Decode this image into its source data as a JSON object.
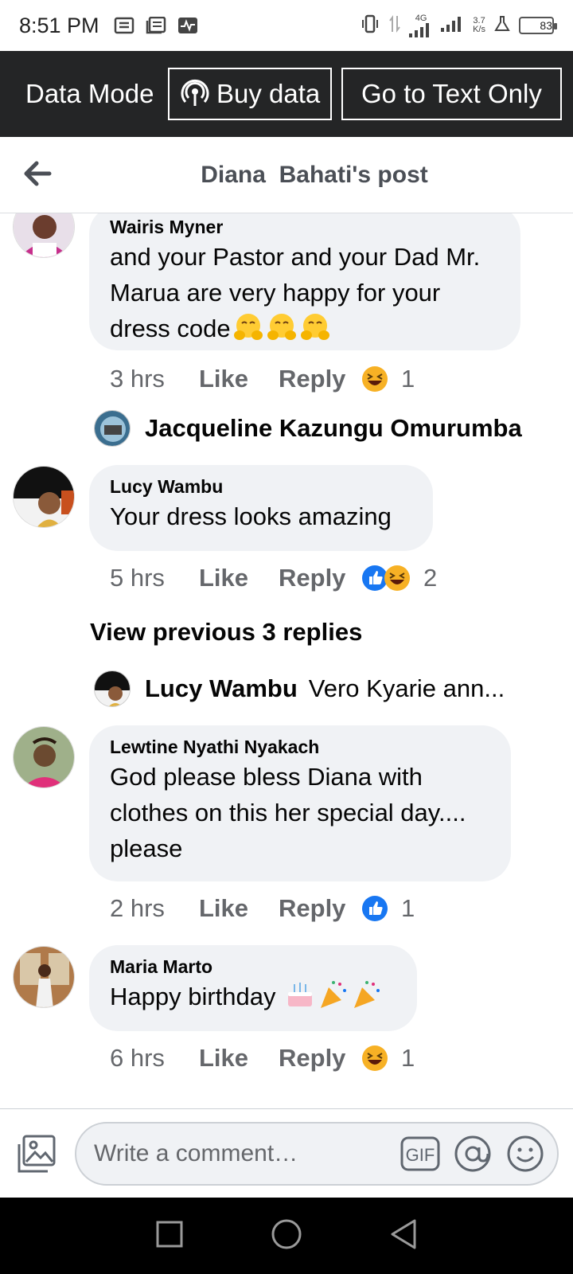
{
  "status_bar": {
    "time": "8:51 PM",
    "network_type": "4G",
    "speed_value": "3.7",
    "speed_unit": "K/s",
    "battery": "83"
  },
  "data_bar": {
    "mode_label": "Data Mode",
    "buy_label": "Buy data",
    "text_only_label": "Go to Text Only"
  },
  "header": {
    "title": "Diana  Bahati's post"
  },
  "comments": [
    {
      "author": "Wairis Myner",
      "lines": [
        "and your Pastor and your Dad Mr.",
        "Marua are very happy for your",
        "dress code"
      ],
      "time": "3 hrs",
      "like": "Like",
      "reply": "Reply",
      "reaction_count": "1"
    },
    {
      "author": "Lucy Wambu",
      "lines": [
        "Your dress looks amazing"
      ],
      "time": "5 hrs",
      "like": "Like",
      "reply": "Reply",
      "reaction_count": "2"
    },
    {
      "author": "Lewtine Nyathi Nyakach",
      "lines": [
        "God please bless Diana with",
        "clothes on this her special day....",
        "please"
      ],
      "time": "2 hrs",
      "like": "Like",
      "reply": "Reply",
      "reaction_count": "1"
    },
    {
      "author": "Maria Marto",
      "lines": [
        "Happy birthday"
      ],
      "time": "6 hrs",
      "like": "Like",
      "reply": "Reply",
      "reaction_count": "1"
    }
  ],
  "replies": [
    {
      "name": "Jacqueline Kazungu Omurumba",
      "preview": ""
    },
    {
      "name": "Lucy Wambu",
      "preview": "Vero Kyarie ann..."
    }
  ],
  "view_previous": "View previous 3 replies",
  "composer": {
    "placeholder": "Write a comment…",
    "gif_label": "GIF"
  },
  "colors": {
    "data_bar_bg": "#242526",
    "bubble_bg": "#f0f2f5",
    "like_blue": "#1877f2",
    "meta_gray": "#65676b"
  }
}
